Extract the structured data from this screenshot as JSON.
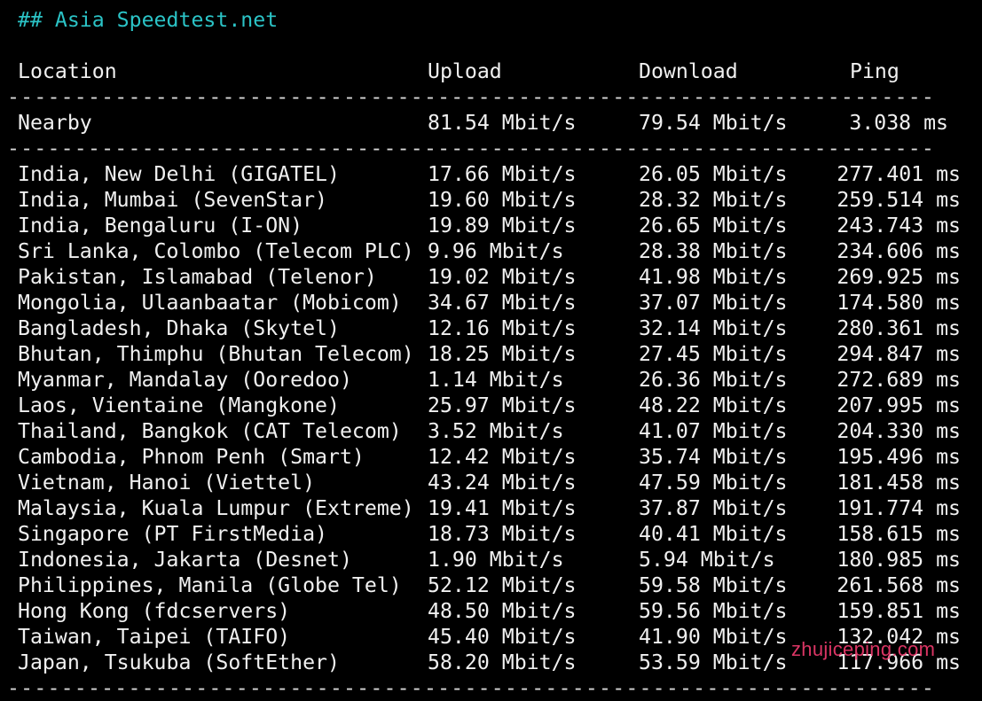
{
  "heading": "## Asia Speedtest.net",
  "columns": {
    "location": "Location",
    "upload": "Upload",
    "download": "Download",
    "ping": "Ping"
  },
  "separator": "--------------------------------------------------------------------------------",
  "nearby": {
    "location": "Nearby",
    "upload": "81.54 Mbit/s",
    "download": "79.54 Mbit/s",
    "ping": "3.038 ms"
  },
  "rows": [
    {
      "location": "India, New Delhi (GIGATEL)",
      "upload": "17.66 Mbit/s",
      "download": "26.05 Mbit/s",
      "ping": "277.401 ms"
    },
    {
      "location": "India, Mumbai (SevenStar)",
      "upload": "19.60 Mbit/s",
      "download": "28.32 Mbit/s",
      "ping": "259.514 ms"
    },
    {
      "location": "India, Bengaluru (I-ON)",
      "upload": "19.89 Mbit/s",
      "download": "26.65 Mbit/s",
      "ping": "243.743 ms"
    },
    {
      "location": "Sri Lanka, Colombo (Telecom PLC)",
      "upload": "9.96 Mbit/s",
      "download": "28.38 Mbit/s",
      "ping": "234.606 ms"
    },
    {
      "location": "Pakistan, Islamabad (Telenor)",
      "upload": "19.02 Mbit/s",
      "download": "41.98 Mbit/s",
      "ping": "269.925 ms"
    },
    {
      "location": "Mongolia, Ulaanbaatar (Mobicom)",
      "upload": "34.67 Mbit/s",
      "download": "37.07 Mbit/s",
      "ping": "174.580 ms"
    },
    {
      "location": "Bangladesh, Dhaka (Skytel)",
      "upload": "12.16 Mbit/s",
      "download": "32.14 Mbit/s",
      "ping": "280.361 ms"
    },
    {
      "location": "Bhutan, Thimphu (Bhutan Telecom)",
      "upload": "18.25 Mbit/s",
      "download": "27.45 Mbit/s",
      "ping": "294.847 ms"
    },
    {
      "location": "Myanmar, Mandalay (Ooredoo)",
      "upload": "1.14 Mbit/s",
      "download": "26.36 Mbit/s",
      "ping": "272.689 ms"
    },
    {
      "location": "Laos, Vientaine (Mangkone)",
      "upload": "25.97 Mbit/s",
      "download": "48.22 Mbit/s",
      "ping": "207.995 ms"
    },
    {
      "location": "Thailand, Bangkok (CAT Telecom)",
      "upload": "3.52 Mbit/s",
      "download": "41.07 Mbit/s",
      "ping": "204.330 ms"
    },
    {
      "location": "Cambodia, Phnom Penh (Smart)",
      "upload": "12.42 Mbit/s",
      "download": "35.74 Mbit/s",
      "ping": "195.496 ms"
    },
    {
      "location": "Vietnam, Hanoi (Viettel)",
      "upload": "43.24 Mbit/s",
      "download": "47.59 Mbit/s",
      "ping": "181.458 ms"
    },
    {
      "location": "Malaysia, Kuala Lumpur (Extreme)",
      "upload": "19.41 Mbit/s",
      "download": "37.87 Mbit/s",
      "ping": "191.774 ms"
    },
    {
      "location": "Singapore (PT FirstMedia)",
      "upload": "18.73 Mbit/s",
      "download": "40.41 Mbit/s",
      "ping": "158.615 ms"
    },
    {
      "location": "Indonesia, Jakarta (Desnet)",
      "upload": "1.90 Mbit/s",
      "download": "5.94 Mbit/s",
      "ping": "180.985 ms"
    },
    {
      "location": "Philippines, Manila (Globe Tel)",
      "upload": "52.12 Mbit/s",
      "download": "59.58 Mbit/s",
      "ping": "261.568 ms"
    },
    {
      "location": "Hong Kong (fdcservers)",
      "upload": "48.50 Mbit/s",
      "download": "59.56 Mbit/s",
      "ping": "159.851 ms"
    },
    {
      "location": "Taiwan, Taipei (TAIFO)",
      "upload": "45.40 Mbit/s",
      "download": "41.90 Mbit/s",
      "ping": "132.042 ms"
    },
    {
      "location": "Japan, Tsukuba (SoftEther)",
      "upload": "58.20 Mbit/s",
      "download": "53.59 Mbit/s",
      "ping": "117.966 ms"
    }
  ],
  "watermark": "zhujiceping.com",
  "colors": {
    "background": "#000000",
    "text": "#f0f0f0",
    "heading": "#2bc3c6",
    "watermark": "#f23b6f"
  }
}
